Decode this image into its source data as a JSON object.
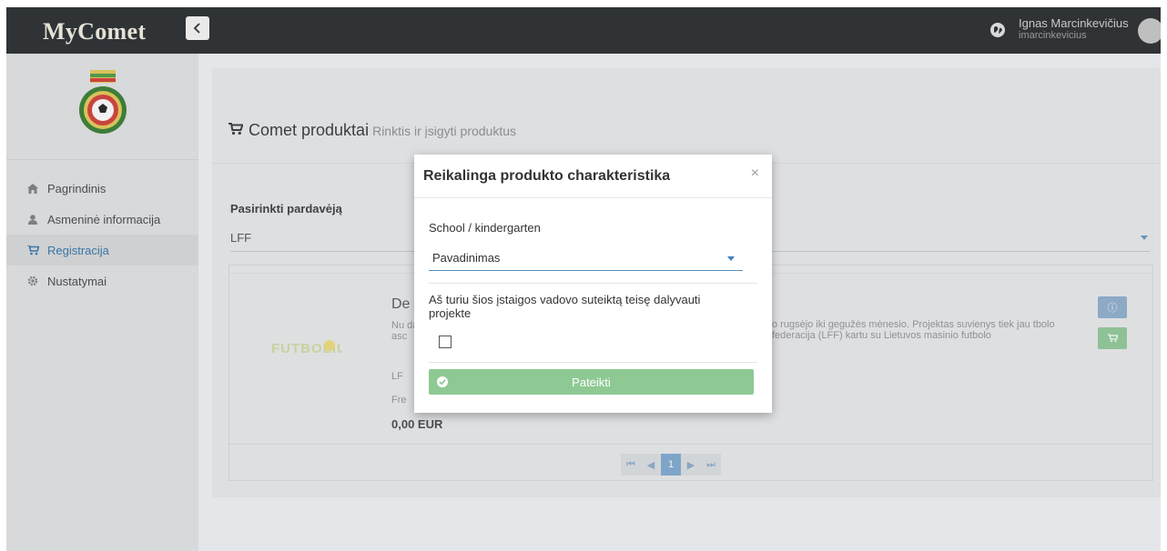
{
  "app": {
    "brand": "MyComet"
  },
  "user": {
    "name": "Ignas Marcinkevičius",
    "login": "imarcinkevicius"
  },
  "sidebar": {
    "items": [
      {
        "label": "Pagrindinis",
        "icon": "home-icon",
        "active": false
      },
      {
        "label": "Asmeninė informacija",
        "icon": "user-icon",
        "active": false
      },
      {
        "label": "Registracija",
        "icon": "cart-icon",
        "active": true
      },
      {
        "label": "Nustatymai",
        "icon": "gear-icon",
        "active": false
      }
    ]
  },
  "page": {
    "title": "Comet produktai",
    "subtitle": "Rinktis ir įsigyti produktus",
    "vendor_label": "Pasirinkti pardavėją",
    "vendor_value": "LFF"
  },
  "product": {
    "title": "De",
    "desc_left": "Nu dal asc",
    "desc_right": "o rugsėjo iki gegužės mėnesio. Projektas suvienys tiek jau tbolo federacija (LFF) kartu su Lietuvos masinio futbolo",
    "line1": "LF",
    "line2": "Fre",
    "price": "0,00 EUR",
    "logo_text": "FUTBOLIUKAS"
  },
  "pager": {
    "first": "⏮",
    "prev": "◀",
    "current": "1",
    "next": "▶",
    "last": "⏭"
  },
  "modal": {
    "title": "Reikalinga produkto charakteristika",
    "close": "×",
    "school_label": "School / kindergarten",
    "school_value": "Pavadinimas",
    "consent_text": "Aš turiu šios įstaigos vadovo suteiktą teisę dalyvauti projekte",
    "submit_label": "Pateikti"
  },
  "colors": {
    "topbar": "#2f3336",
    "accent": "#3a76a6",
    "submit": "#8ec993"
  }
}
